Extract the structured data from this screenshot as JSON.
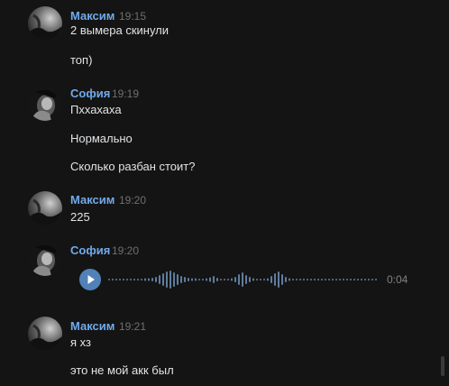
{
  "messages": [
    {
      "author": "Максим",
      "time": "19:15",
      "lines": [
        "2 вымера скинули",
        "топ)"
      ]
    },
    {
      "author": "София",
      "time": "19:19",
      "lines": [
        "Пххахаха",
        "Нормально",
        "Сколько разбан стоит?"
      ]
    },
    {
      "author": "Максим",
      "time": "19:20",
      "lines": [
        "225"
      ]
    },
    {
      "author": "София",
      "time": "19:20",
      "voice": {
        "duration": "0:04",
        "icon": "play-icon",
        "played_fraction": 0
      }
    },
    {
      "author": "Максим",
      "time": "19:21",
      "lines": [
        "я хз",
        "это не мой акк был"
      ]
    }
  ],
  "colors": {
    "background": "#141414",
    "author": "#71aaeb",
    "text": "#e1e3e6",
    "time": "#6f6f6f",
    "accent": "#5181b8",
    "waveform": "#5f7d9e"
  }
}
